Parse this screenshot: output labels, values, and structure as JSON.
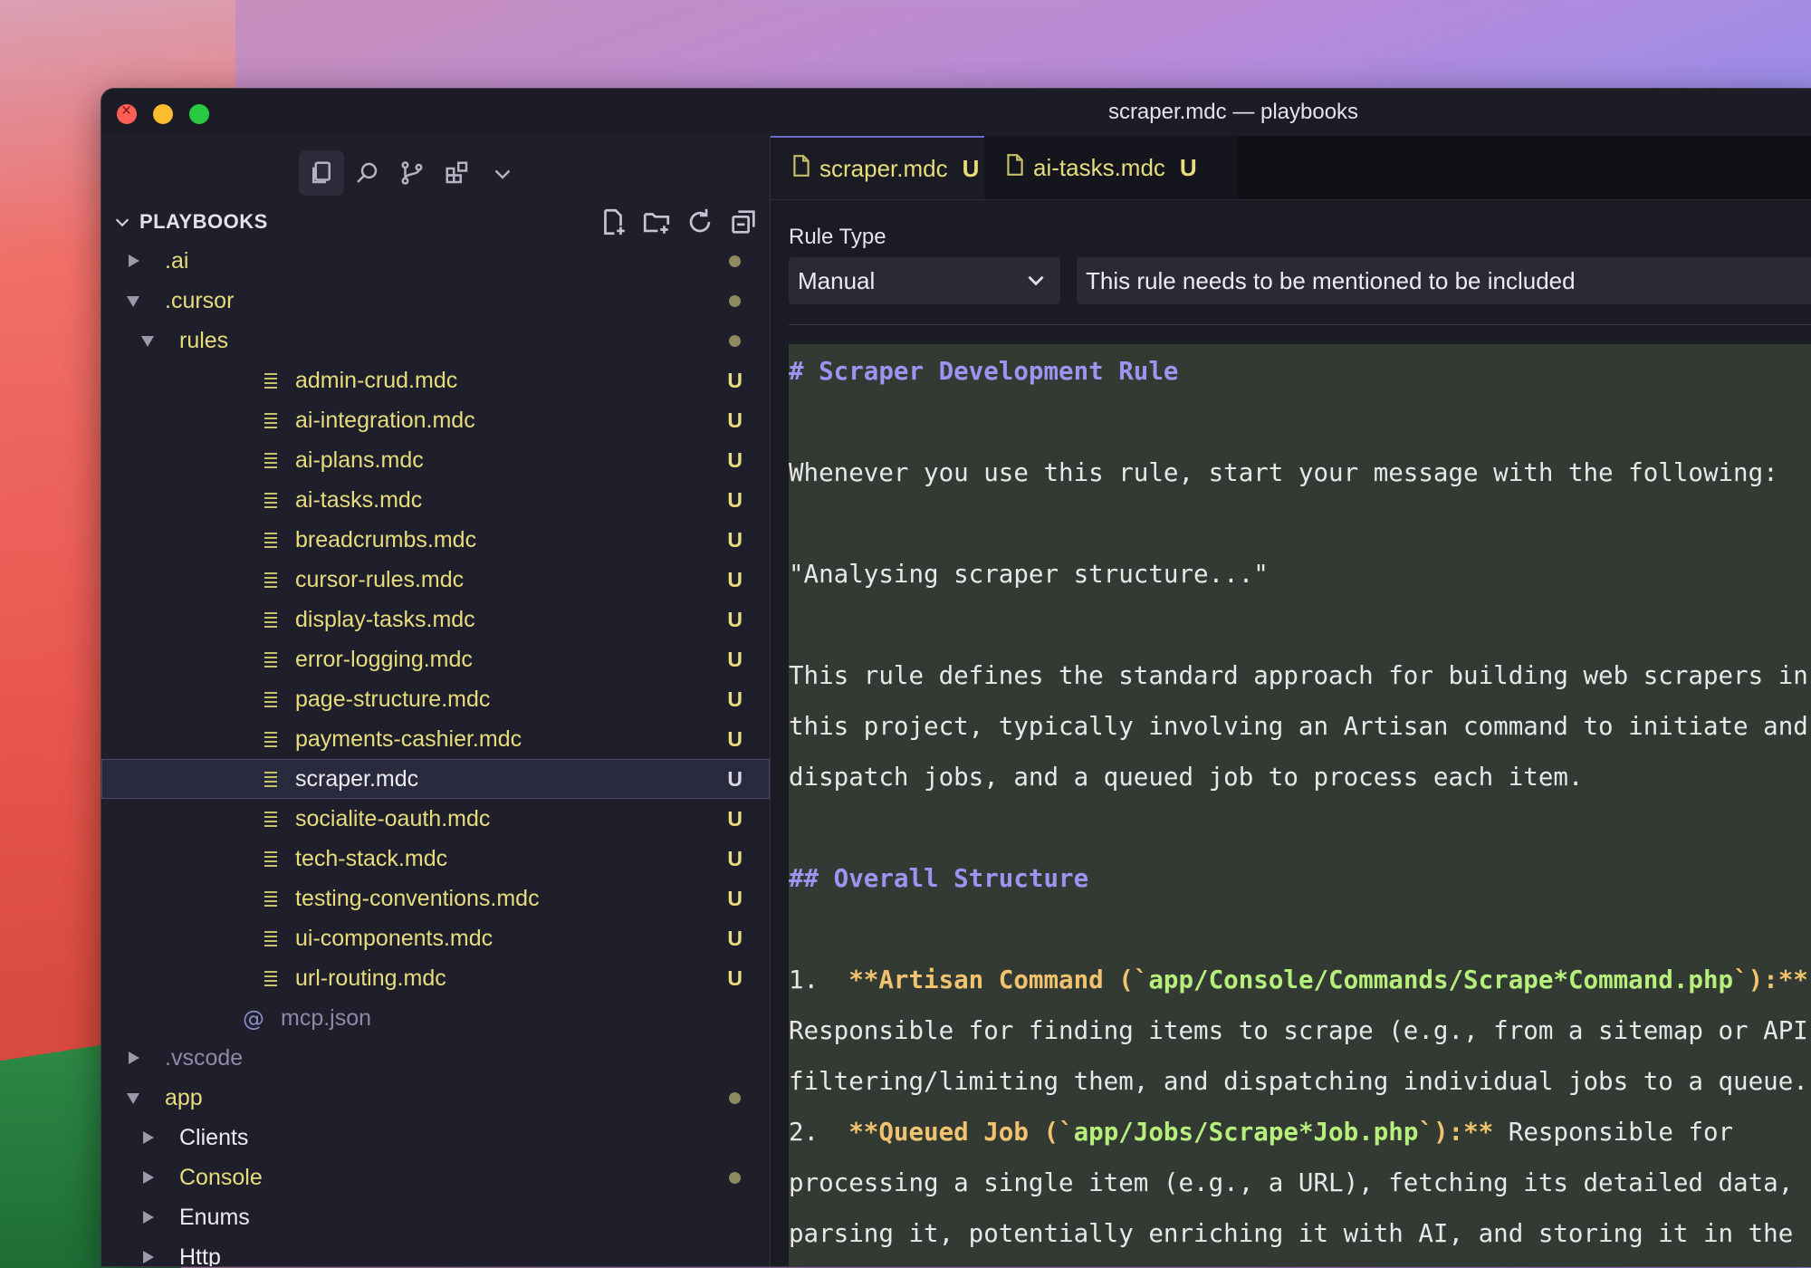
{
  "window": {
    "title": "scraper.mdc — playbooks"
  },
  "explorer": {
    "section_title": "PLAYBOOKS",
    "tree": [
      {
        "label": "🗀",
        "text": ".ai",
        "kind": "folder",
        "open": false,
        "depth": 0,
        "badge": "dot"
      },
      {
        "text": ".cursor",
        "kind": "folder",
        "open": true,
        "depth": 0,
        "badge": "dot"
      },
      {
        "text": "rules",
        "kind": "folder",
        "open": true,
        "depth": 1,
        "badge": "dot"
      },
      {
        "text": "admin-crud.mdc",
        "kind": "file",
        "depth": 2,
        "badge": "U"
      },
      {
        "text": "ai-integration.mdc",
        "kind": "file",
        "depth": 2,
        "badge": "U"
      },
      {
        "text": "ai-plans.mdc",
        "kind": "file",
        "depth": 2,
        "badge": "U"
      },
      {
        "text": "ai-tasks.mdc",
        "kind": "file",
        "depth": 2,
        "badge": "U"
      },
      {
        "text": "breadcrumbs.mdc",
        "kind": "file",
        "depth": 2,
        "badge": "U"
      },
      {
        "text": "cursor-rules.mdc",
        "kind": "file",
        "depth": 2,
        "badge": "U"
      },
      {
        "text": "display-tasks.mdc",
        "kind": "file",
        "depth": 2,
        "badge": "U"
      },
      {
        "text": "error-logging.mdc",
        "kind": "file",
        "depth": 2,
        "badge": "U"
      },
      {
        "text": "page-structure.mdc",
        "kind": "file",
        "depth": 2,
        "badge": "U"
      },
      {
        "text": "payments-cashier.mdc",
        "kind": "file",
        "depth": 2,
        "badge": "U"
      },
      {
        "text": "scraper.mdc",
        "kind": "file",
        "depth": 2,
        "badge": "U",
        "selected": true
      },
      {
        "text": "socialite-oauth.mdc",
        "kind": "file",
        "depth": 2,
        "badge": "U"
      },
      {
        "text": "tech-stack.mdc",
        "kind": "file",
        "depth": 2,
        "badge": "U"
      },
      {
        "text": "testing-conventions.mdc",
        "kind": "file",
        "depth": 2,
        "badge": "U"
      },
      {
        "text": "ui-components.mdc",
        "kind": "file",
        "depth": 2,
        "badge": "U"
      },
      {
        "text": "url-routing.mdc",
        "kind": "file",
        "depth": 2,
        "badge": "U"
      },
      {
        "text": "mcp.json",
        "kind": "json",
        "depth": 1,
        "badge": ""
      },
      {
        "text": ".vscode",
        "kind": "folder",
        "open": false,
        "depth": 0,
        "badge": "",
        "dim": true
      },
      {
        "text": "app",
        "kind": "folder",
        "open": true,
        "depth": 0,
        "badge": "dot",
        "color": "yellow"
      },
      {
        "text": "Clients",
        "kind": "folder",
        "open": false,
        "depth": 1,
        "badge": "",
        "color": "white"
      },
      {
        "text": "Console",
        "kind": "folder",
        "open": false,
        "depth": 1,
        "badge": "dot",
        "color": "yellow"
      },
      {
        "text": "Enums",
        "kind": "folder",
        "open": false,
        "depth": 1,
        "badge": "",
        "color": "white"
      },
      {
        "text": "Http",
        "kind": "folder",
        "open": false,
        "depth": 1,
        "badge": "",
        "color": "white"
      }
    ]
  },
  "tabs": [
    {
      "name": "scraper.mdc",
      "status": "U",
      "dirty": true,
      "active": true
    },
    {
      "name": "ai-tasks.mdc",
      "status": "U",
      "dirty": false,
      "active": false
    }
  ],
  "rule": {
    "label": "Rule Type",
    "type_value": "Manual",
    "description": "This rule needs to be mentioned to be included"
  },
  "code_lines": [
    {
      "segs": [
        {
          "t": "# Scraper Development Rule",
          "c": "h"
        }
      ]
    },
    {
      "segs": [
        {
          "t": "Whenever you use this rule, start your message with the following:",
          "c": ""
        }
      ]
    },
    {
      "segs": [
        {
          "t": "\"Analysing scraper structure...\"",
          "c": ""
        }
      ]
    },
    {
      "segs": [
        {
          "t": "This rule defines the standard approach for building web scrapers in",
          "c": ""
        }
      ]
    },
    {
      "segs": [
        {
          "t": "this project, typically involving an Artisan command to initiate and",
          "c": ""
        }
      ]
    },
    {
      "segs": [
        {
          "t": "dispatch jobs, and a queued job to process each item.",
          "c": ""
        }
      ]
    },
    {
      "segs": [
        {
          "t": "## Overall Structure",
          "c": "h"
        }
      ]
    },
    {
      "segs": [
        {
          "t": "1.  ",
          "c": ""
        },
        {
          "t": "**Artisan Command (`",
          "c": "bold-o"
        },
        {
          "t": "app/Console/Commands/Scrape*Command.php",
          "c": "bold-g"
        },
        {
          "t": "`):**",
          "c": "bold-o"
        }
      ]
    },
    {
      "segs": [
        {
          "t": "Responsible for finding items to scrape (e.g., from a sitemap or API),",
          "c": ""
        }
      ]
    },
    {
      "segs": [
        {
          "t": "filtering/limiting them, and dispatching individual jobs to a queue.",
          "c": ""
        }
      ]
    },
    {
      "segs": [
        {
          "t": "2.  ",
          "c": ""
        },
        {
          "t": "**Queued Job (`",
          "c": "bold-o"
        },
        {
          "t": "app/Jobs/Scrape*Job.php",
          "c": "bold-g"
        },
        {
          "t": "`):**",
          "c": "bold-o"
        },
        {
          "t": " Responsible for",
          "c": ""
        }
      ]
    },
    {
      "segs": [
        {
          "t": "processing a single item (e.g., a URL), fetching its detailed data,",
          "c": ""
        }
      ]
    },
    {
      "segs": [
        {
          "t": "parsing it, potentially enriching it with AI, and storing it in the",
          "c": ""
        }
      ]
    }
  ]
}
